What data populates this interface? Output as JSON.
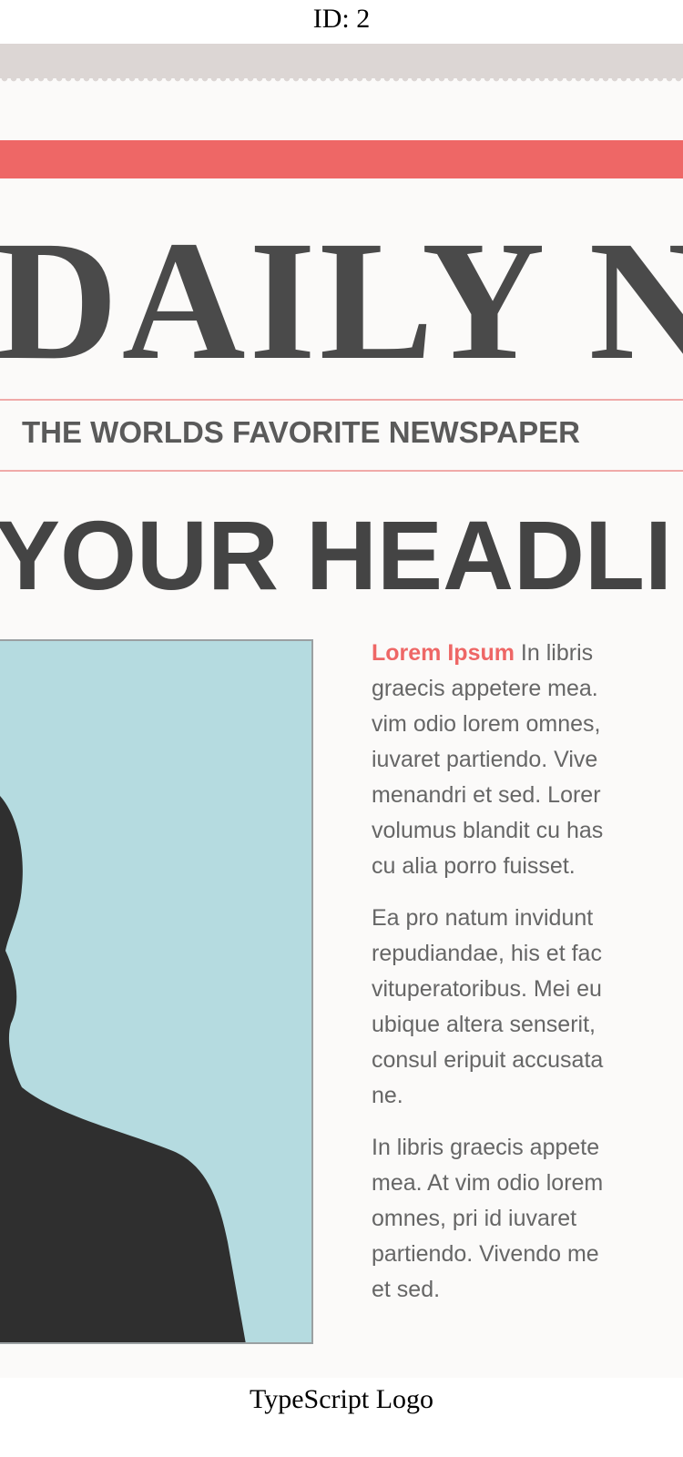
{
  "id_label": "ID: 2",
  "newspaper": {
    "masthead": "DAILY N",
    "tagline": "THE WORLDS FAVORITE NEWSPAPER",
    "headline": "YOUR HEADLI",
    "article": {
      "lead": "Lorem Ipsum",
      "p1_lines": [
        " In libris",
        "graecis appetere mea.",
        "vim odio lorem omnes,",
        "iuvaret partiendo. Vive",
        "menandri et sed. Lorer",
        "volumus blandit cu has",
        "cu alia porro fuisset."
      ],
      "p2_lines": [
        "Ea pro natum invidunt",
        "repudiandae, his et fac",
        "vituperatoribus. Mei eu",
        "ubique altera senserit,",
        "consul eripuit accusata",
        "ne."
      ],
      "p3_lines": [
        "In libris graecis appete",
        "mea. At vim odio lorem",
        "omnes, pri id iuvaret",
        "partiendo. Vivendo me",
        "et sed."
      ]
    },
    "colors": {
      "accent_red": "#ee6766",
      "photo_bg": "#b5dbe0",
      "silhouette": "#2f2f2f",
      "ink": "#4a4a4a"
    }
  },
  "caption": "TypeScript Logo"
}
